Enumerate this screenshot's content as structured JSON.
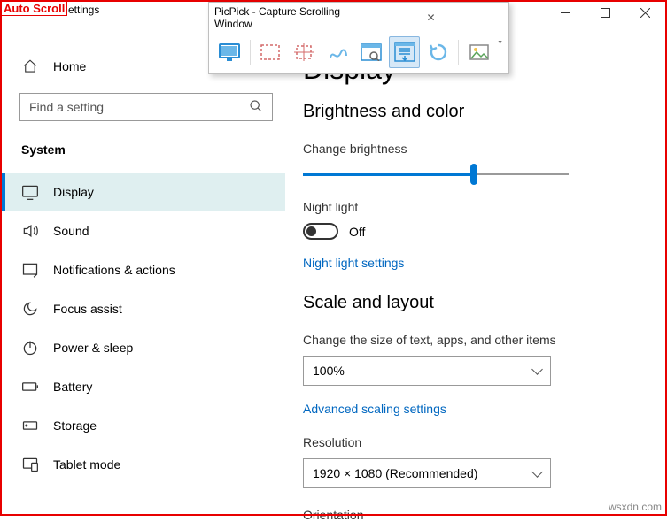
{
  "overlay": {
    "autoscroll_label": "Auto Scroll",
    "window_title_fragment": "ettings"
  },
  "picpick": {
    "title": "PicPick - Capture Scrolling Window",
    "tools": [
      "fullscreen",
      "region",
      "fixed-region",
      "freehand",
      "window",
      "scrolling-window",
      "repeat",
      "image"
    ]
  },
  "sidebar": {
    "home": "Home",
    "search_placeholder": "Find a setting",
    "section": "System",
    "items": [
      {
        "icon": "display",
        "label": "Display",
        "selected": true
      },
      {
        "icon": "sound",
        "label": "Sound"
      },
      {
        "icon": "notifications",
        "label": "Notifications & actions"
      },
      {
        "icon": "focus",
        "label": "Focus assist"
      },
      {
        "icon": "power",
        "label": "Power & sleep"
      },
      {
        "icon": "battery",
        "label": "Battery"
      },
      {
        "icon": "storage",
        "label": "Storage"
      },
      {
        "icon": "tablet",
        "label": "Tablet mode"
      }
    ]
  },
  "main": {
    "title": "Display",
    "section_brightness": "Brightness and color",
    "brightness_label": "Change brightness",
    "brightness_percent": 63,
    "nightlight_label": "Night light",
    "nightlight_state": "Off",
    "nightlight_link": "Night light settings",
    "section_scale": "Scale and layout",
    "scale_label": "Change the size of text, apps, and other items",
    "scale_value": "100%",
    "scale_link": "Advanced scaling settings",
    "resolution_label": "Resolution",
    "resolution_value": "1920 × 1080 (Recommended)",
    "orientation_label": "Orientation"
  },
  "watermark": "wsxdn.com"
}
